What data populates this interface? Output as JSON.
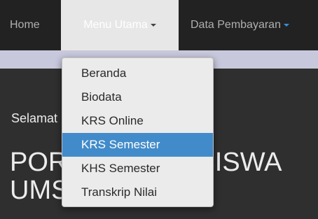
{
  "navbar": {
    "items": [
      {
        "label": "Home"
      },
      {
        "label": "Menu Utama"
      },
      {
        "label": "Data Pembayaran"
      }
    ]
  },
  "dropdown": {
    "items": [
      {
        "label": "Beranda"
      },
      {
        "label": "Biodata"
      },
      {
        "label": "KRS Online"
      },
      {
        "label": "KRS Semester",
        "active": true
      },
      {
        "label": "KHS Semester"
      },
      {
        "label": "Transkrip Nilai"
      }
    ]
  },
  "main": {
    "welcome": "Selamat Datang di",
    "title": "PORTAL MAHASISWA UMSU"
  },
  "colors": {
    "navbar_bg": "#222222",
    "active_nav_bg": "#e7e7e7",
    "highlight": "#428bca",
    "content_bg": "#2f2f2f"
  }
}
